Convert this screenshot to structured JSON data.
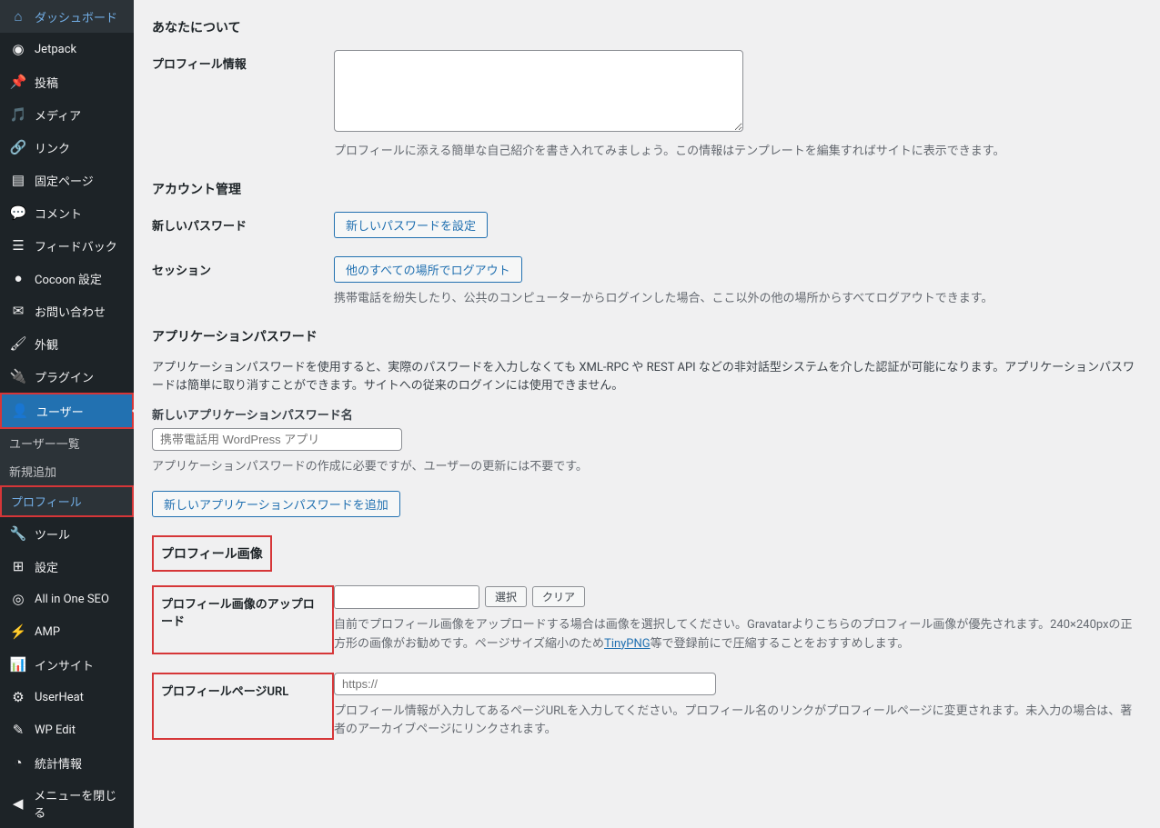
{
  "sidebar": {
    "items": [
      {
        "icon": "dashboard",
        "label": "ダッシュボード"
      },
      {
        "icon": "jetpack",
        "label": "Jetpack"
      },
      {
        "icon": "pin",
        "label": "投稿"
      },
      {
        "icon": "media",
        "label": "メディア"
      },
      {
        "icon": "link",
        "label": "リンク"
      },
      {
        "icon": "page",
        "label": "固定ページ"
      },
      {
        "icon": "comment",
        "label": "コメント"
      },
      {
        "icon": "feedback",
        "label": "フィードバック"
      },
      {
        "icon": "cocoon",
        "label": "Cocoon 設定"
      },
      {
        "icon": "mail",
        "label": "お問い合わせ"
      },
      {
        "icon": "appearance",
        "label": "外観"
      },
      {
        "icon": "plugin",
        "label": "プラグイン"
      }
    ],
    "users": {
      "label": "ユーザー"
    },
    "sub": [
      {
        "label": "ユーザー一覧"
      },
      {
        "label": "新規追加"
      },
      {
        "label": "プロフィール"
      }
    ],
    "items2": [
      {
        "icon": "tools",
        "label": "ツール"
      },
      {
        "icon": "settings",
        "label": "設定"
      },
      {
        "icon": "aioseo",
        "label": "All in One SEO"
      },
      {
        "icon": "amp",
        "label": "AMP"
      },
      {
        "icon": "insights",
        "label": "インサイト"
      },
      {
        "icon": "userheat",
        "label": "UserHeat"
      },
      {
        "icon": "wpedit",
        "label": "WP Edit"
      },
      {
        "icon": "stats",
        "label": "統計情報"
      },
      {
        "icon": "collapse",
        "label": "メニューを閉じる"
      }
    ]
  },
  "sections": {
    "about": {
      "heading": "あなたについて",
      "profileInfo": {
        "label": "プロフィール情報",
        "desc": "プロフィールに添える簡単な自己紹介を書き入れてみましょう。この情報はテンプレートを編集すればサイトに表示できます。"
      }
    },
    "account": {
      "heading": "アカウント管理",
      "newPassword": {
        "label": "新しいパスワード",
        "button": "新しいパスワードを設定"
      },
      "session": {
        "label": "セッション",
        "button": "他のすべての場所でログアウト",
        "desc": "携帯電話を紛失したり、公共のコンピューターからログインした場合、ここ以外の他の場所からすべてログアウトできます。"
      }
    },
    "appPassword": {
      "heading": "アプリケーションパスワード",
      "desc": "アプリケーションパスワードを使用すると、実際のパスワードを入力しなくても XML-RPC や REST API などの非対話型システムを介した認証が可能になります。アプリケーションパスワードは簡単に取り消すことができます。サイトへの従来のログインには使用できません。",
      "nameLabel": "新しいアプリケーションパスワード名",
      "placeholder": "携帯電話用 WordPress アプリ",
      "help": "アプリケーションパスワードの作成に必要ですが、ユーザーの更新には不要です。",
      "addButton": "新しいアプリケーションパスワードを追加"
    },
    "profileImage": {
      "heading": "プロフィール画像",
      "upload": {
        "label": "プロフィール画像のアップロード",
        "selectBtn": "選択",
        "clearBtn": "クリア",
        "desc1": "自前でプロフィール画像をアップロードする場合は画像を選択してください。Gravatarよりこちらのプロフィール画像が優先されます。240×240pxの正方形の画像がお勧めです。ページサイズ縮小のため",
        "link": "TinyPNG",
        "desc2": "等で登録前にで圧縮することをおすすめします。"
      },
      "url": {
        "label": "プロフィールページURL",
        "placeholder": "https://",
        "desc": "プロフィール情報が入力してあるページURLを入力してください。プロフィール名のリンクがプロフィールページに変更されます。未入力の場合は、著者のアーカイブページにリンクされます。"
      }
    }
  }
}
